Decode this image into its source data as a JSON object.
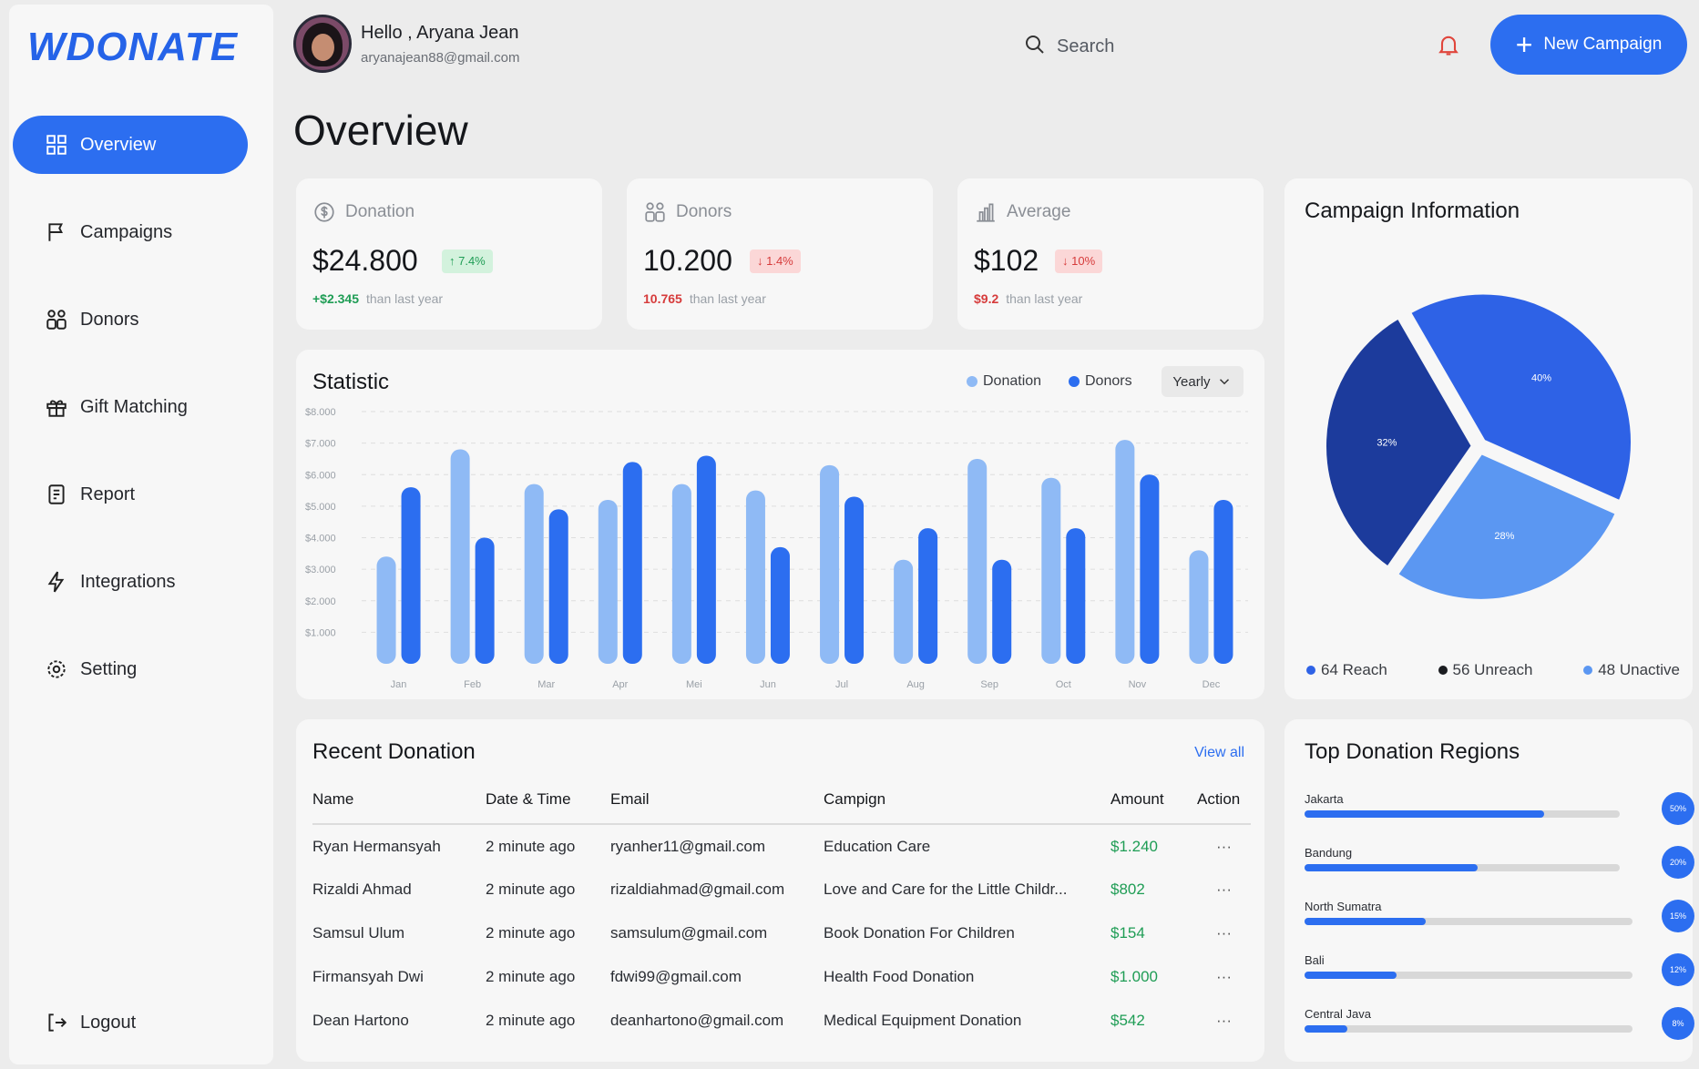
{
  "brand": {
    "logo": "WDONATE"
  },
  "sidebar": {
    "items": [
      {
        "label": "Overview",
        "icon": "grid-icon",
        "active": true
      },
      {
        "label": "Campaigns",
        "icon": "flag-icon"
      },
      {
        "label": "Donors",
        "icon": "users-icon"
      },
      {
        "label": "Gift Matching",
        "icon": "gift-icon"
      },
      {
        "label": "Report",
        "icon": "report-icon"
      },
      {
        "label": "Integrations",
        "icon": "lightning-icon"
      },
      {
        "label": "Setting",
        "icon": "gear-icon"
      }
    ],
    "logout": "Logout"
  },
  "header": {
    "greeting": "Hello , Aryana Jean",
    "email": "aryanajean88@gmail.com",
    "search_placeholder": "Search",
    "new_campaign": "New Campaign"
  },
  "page_title": "Overview",
  "stats": [
    {
      "label": "Donation",
      "value": "$24.800",
      "badge": "↑ 7.4%",
      "trend": "up",
      "delta": "+$2.345",
      "note": "than last year"
    },
    {
      "label": "Donors",
      "value": "10.200",
      "badge": "↓ 1.4%",
      "trend": "down",
      "delta": "10.765",
      "note": "than last year"
    },
    {
      "label": "Average",
      "value": "$102",
      "badge": "↓ 10%",
      "trend": "down",
      "delta": "$9.2",
      "note": "than last year"
    }
  ],
  "statistic": {
    "title": "Statistic",
    "legend": [
      "Donation",
      "Donors"
    ],
    "period": "Yearly"
  },
  "chart_data": {
    "type": "bar",
    "categories": [
      "Jan",
      "Feb",
      "Mar",
      "Apr",
      "Mei",
      "Jun",
      "Jul",
      "Aug",
      "Sep",
      "Oct",
      "Nov",
      "Dec"
    ],
    "yticks": [
      "$8.000",
      "$7.000",
      "$6.000",
      "$5.000",
      "$4.000",
      "$3.000",
      "$2.000",
      "$1.000"
    ],
    "ylim": [
      0,
      8000
    ],
    "series": [
      {
        "name": "Donation",
        "color": "#8fbaf5",
        "values": [
          3400,
          6800,
          5700,
          5200,
          5700,
          5500,
          6300,
          3300,
          6500,
          5900,
          7100,
          3600
        ]
      },
      {
        "name": "Donors",
        "color": "#2c6ef0",
        "values": [
          5600,
          4000,
          4900,
          6400,
          6600,
          3700,
          5300,
          4300,
          3300,
          4300,
          6000,
          5200
        ]
      }
    ],
    "grid": true
  },
  "recent": {
    "title": "Recent Donation",
    "view_all": "View all",
    "columns": [
      "Name",
      "Date & Time",
      "Email",
      "Campign",
      "Amount",
      "Action"
    ],
    "rows": [
      [
        "Ryan Hermansyah",
        "2 minute ago",
        "ryanher11@gmail.com",
        "Education Care",
        "$1.240",
        "···"
      ],
      [
        "Rizaldi Ahmad",
        "2 minute ago",
        "rizaldiahmad@gmail.com",
        "Love and Care for the Little Childr...",
        "$802",
        "···"
      ],
      [
        "Samsul Ulum",
        "2 minute ago",
        "samsulum@gmail.com",
        "Book Donation For Children",
        "$154",
        "···"
      ],
      [
        "Firmansyah Dwi",
        "2 minute ago",
        "fdwi99@gmail.com",
        "Health Food Donation",
        "$1.000",
        "···"
      ],
      [
        "Dean Hartono",
        "2 minute ago",
        "deanhartono@gmail.com",
        "Medical Equipment Donation",
        "$542",
        "···"
      ]
    ]
  },
  "campaign": {
    "title": "Campaign Information",
    "slices": [
      {
        "label": "40%",
        "value": 40,
        "color": "#2e62e6"
      },
      {
        "label": "28%",
        "value": 28,
        "color": "#5b97f2"
      },
      {
        "label": "32%",
        "value": 32,
        "color": "#1c3b9c"
      }
    ],
    "legend": [
      {
        "label": "64 Reach",
        "color": "#2e62e6"
      },
      {
        "label": "56 Unreach",
        "color": "#1a1c20"
      },
      {
        "label": "48 Unactive",
        "color": "#5b97f2"
      }
    ]
  },
  "regions": {
    "title": "Top Donation Regions",
    "items": [
      {
        "name": "Jakarta",
        "percent": 76,
        "badge": "50%"
      },
      {
        "name": "Bandung",
        "percent": 55,
        "badge": "20%"
      },
      {
        "name": "North Sumatra",
        "percent": 37,
        "badge": "15%"
      },
      {
        "name": "Bali",
        "percent": 28,
        "badge": "12%"
      },
      {
        "name": "Central Java",
        "percent": 13,
        "badge": "8%"
      }
    ]
  }
}
